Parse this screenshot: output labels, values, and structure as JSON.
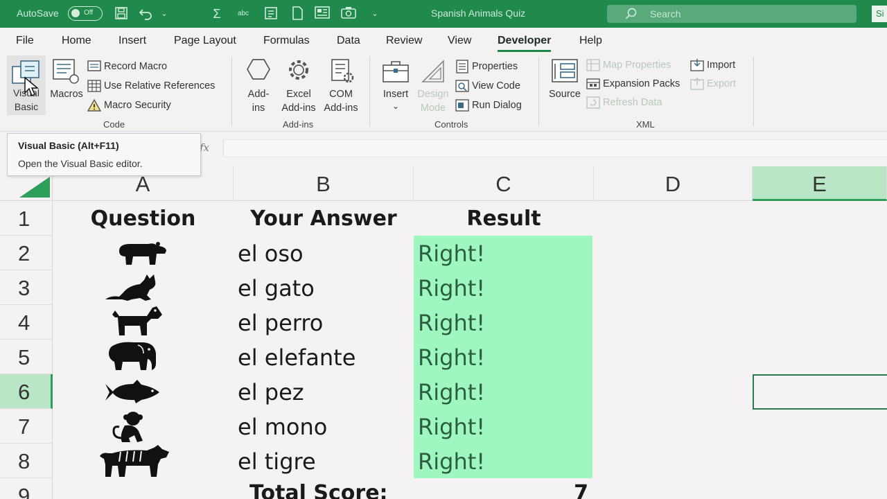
{
  "titlebar": {
    "autosave_label": "AutoSave",
    "autosave_state": "Off",
    "document_title": "Spanish Animals Quiz",
    "search_placeholder": "Search",
    "user_initials": "Si"
  },
  "tabs": [
    {
      "label": "File"
    },
    {
      "label": "Home"
    },
    {
      "label": "Insert"
    },
    {
      "label": "Page Layout"
    },
    {
      "label": "Formulas"
    },
    {
      "label": "Data"
    },
    {
      "label": "Review"
    },
    {
      "label": "View"
    },
    {
      "label": "Developer",
      "active": true
    },
    {
      "label": "Help"
    }
  ],
  "ribbon": {
    "code": {
      "label": "Code",
      "visual_basic_line1": "Visual",
      "visual_basic_line2": "Basic",
      "macros": "Macros",
      "record_macro": "Record Macro",
      "use_relative_references": "Use Relative References",
      "macro_security": "Macro Security"
    },
    "addins": {
      "label": "Add-ins",
      "addins_line1": "Add-",
      "addins_line2": "ins",
      "excel_addins_line1": "Excel",
      "excel_addins_line2": "Add-ins",
      "com_addins_line1": "COM",
      "com_addins_line2": "Add-ins"
    },
    "controls": {
      "label": "Controls",
      "insert": "Insert",
      "design_mode_line1": "Design",
      "design_mode_line2": "Mode",
      "properties": "Properties",
      "view_code": "View Code",
      "run_dialog": "Run Dialog"
    },
    "xml": {
      "label": "XML",
      "source": "Source",
      "map_properties": "Map Properties",
      "expansion_packs": "Expansion Packs",
      "refresh_data": "Refresh Data",
      "import": "Import",
      "export": "Export"
    }
  },
  "tooltip": {
    "title": "Visual Basic (Alt+F11)",
    "description": "Open the Visual Basic editor."
  },
  "formula_bar": {
    "fx_label": "fx"
  },
  "sheet": {
    "columns": [
      "A",
      "B",
      "C",
      "D",
      "E"
    ],
    "rows": [
      "1",
      "2",
      "3",
      "4",
      "5",
      "6",
      "7",
      "8",
      "9"
    ],
    "headers": {
      "question": "Question",
      "your_answer": "Your Answer",
      "result": "Result"
    },
    "quiz": [
      {
        "animal_icon": "bear-icon",
        "answer": "el oso",
        "result": "Right!"
      },
      {
        "animal_icon": "cat-icon",
        "answer": "el gato",
        "result": "Right!"
      },
      {
        "animal_icon": "dog-icon",
        "answer": "el perro",
        "result": "Right!"
      },
      {
        "animal_icon": "elephant-icon",
        "answer": "el elefante",
        "result": "Right!"
      },
      {
        "animal_icon": "fish-icon",
        "answer": "el pez",
        "result": "Right!"
      },
      {
        "animal_icon": "monkey-icon",
        "answer": "el mono",
        "result": "Right!"
      },
      {
        "animal_icon": "tiger-icon",
        "answer": "el tigre",
        "result": "Right!"
      }
    ],
    "total_label": "Total Score:",
    "total_value": "7",
    "selected_cell": "E6",
    "result_fill_color": "#9ff7c0",
    "accent_color": "#1f8a4c"
  }
}
